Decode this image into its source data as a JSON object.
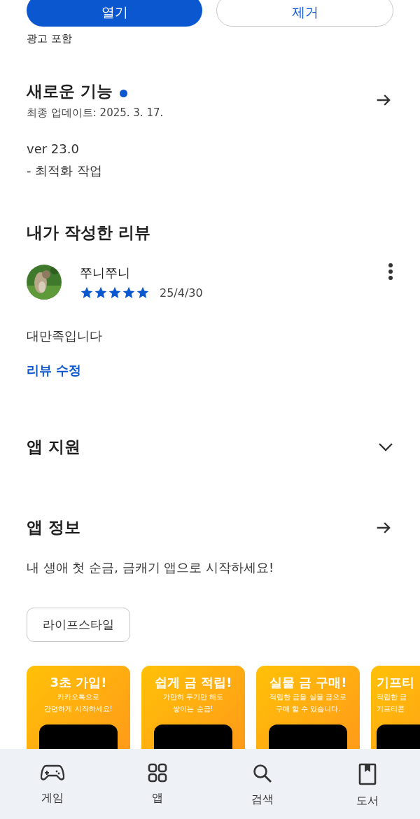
{
  "actions": [
    {
      "label": "열기",
      "kind": "primary"
    },
    {
      "label": "제거",
      "kind": "outline"
    }
  ],
  "ads_note": "광고 포함",
  "whats_new": {
    "title": "새로운 기능",
    "updated": "최종 업데이트: 2025. 3. 17.",
    "lines": [
      "ver 23.0",
      "- 최적화 작업"
    ]
  },
  "my_review": {
    "title": "내가 작성한 리뷰",
    "author": "쭈니쭈니",
    "stars": 5,
    "date": "25/4/30",
    "text": "대만족입니다",
    "edit_link": "리뷰 수정"
  },
  "app_support": {
    "title": "앱 지원",
    "expanded": false
  },
  "app_info": {
    "title": "앱 정보",
    "description": "내 생애 첫 순금, 금캐기 앱으로 시작하세요!",
    "category": "라이프스타일"
  },
  "screenshots": [
    {
      "headline": "3초 가입!",
      "lines": [
        "카카오톡으로",
        "간편하게 시작하세요!"
      ]
    },
    {
      "headline": "쉽게 금 적립!",
      "lines": [
        "가만히 두기만 해도",
        "쌓이는 순금!"
      ]
    },
    {
      "headline": "실물 금 구매!",
      "lines": [
        "적립한 금을 실물 금으로",
        "구매 할 수 있습니다."
      ]
    },
    {
      "headline": "기프티",
      "lines": [
        "적립한 금",
        "기프티콘"
      ]
    }
  ],
  "nav": [
    {
      "label": "게임"
    },
    {
      "label": "앱"
    },
    {
      "label": "검색"
    },
    {
      "label": "도서"
    }
  ]
}
